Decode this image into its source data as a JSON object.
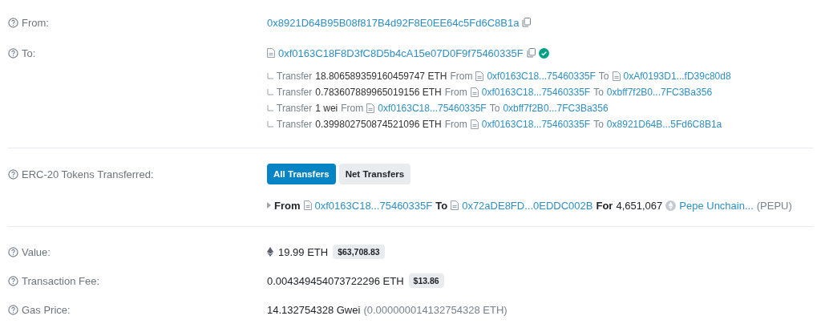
{
  "from": {
    "label": "From:",
    "address": "0x8921D64B95B08f817B4d92F8E0EE64c5Fd6C8B1a",
    "contract": false
  },
  "to": {
    "label": "To:",
    "address": "0xf0163C18F8D3fC8D5b4cA15e07D0F9f75460335F",
    "contract": true,
    "verified": true
  },
  "internal_transfers": [
    {
      "verb": "Transfer",
      "amount": "18.806589359160459747 ETH",
      "from_word": "From",
      "from": {
        "address": "0xf0163C18...75460335F",
        "contract": true
      },
      "to_word": "To",
      "to": {
        "address": "0xAf0193D1...fD39c80d8",
        "contract": true
      }
    },
    {
      "verb": "Transfer",
      "amount": "0.783607889965019156 ETH",
      "from_word": "From",
      "from": {
        "address": "0xf0163C18...75460335F",
        "contract": true
      },
      "to_word": "To",
      "to": {
        "address": "0xbff7f2B0...7FC3Ba356",
        "contract": false
      }
    },
    {
      "verb": "Transfer",
      "amount": "1 wei",
      "from_word": "From",
      "from": {
        "address": "0xf0163C18...75460335F",
        "contract": true
      },
      "to_word": "To",
      "to": {
        "address": "0xbff7f2B0...7FC3Ba356",
        "contract": false
      }
    },
    {
      "verb": "Transfer",
      "amount": "0.399802750874521096 ETH",
      "from_word": "From",
      "from": {
        "address": "0xf0163C18...75460335F",
        "contract": true
      },
      "to_word": "To",
      "to": {
        "address": "0x8921D64B...5Fd6C8B1a",
        "contract": false
      }
    }
  ],
  "tokens": {
    "label": "ERC-20 Tokens Transferred:",
    "tabs": [
      {
        "label": "All Transfers",
        "selected": true
      },
      {
        "label": "Net Transfers",
        "selected": false
      }
    ],
    "transfers": [
      {
        "from_word": "From",
        "from": {
          "address": "0xf0163C18...75460335F",
          "contract": true
        },
        "to_word": "To",
        "to": {
          "address": "0x72aDE8FD...0EDDC002B",
          "contract": true
        },
        "for_word": "For",
        "amount": "4,651,067",
        "token": "Pepe Unchain...",
        "symbol": "(PEPU)"
      }
    ]
  },
  "value": {
    "label": "Value:",
    "amount": "19.99 ETH",
    "usd": "$63,708.83"
  },
  "fee": {
    "label": "Transaction Fee:",
    "amount": "0.004349454073722296 ETH",
    "usd": "$13.86"
  },
  "gas": {
    "label": "Gas Price:",
    "gwei": "14.132754328 Gwei",
    "eth": "(0.000000014132754328 ETH)"
  }
}
